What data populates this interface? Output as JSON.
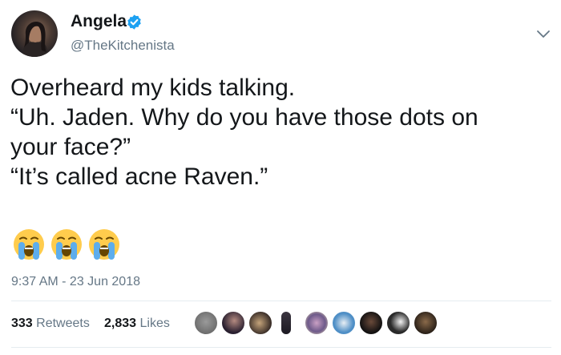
{
  "user": {
    "display_name": "Angela",
    "handle": "@TheKitchenista",
    "verified": true
  },
  "tweet": {
    "lines": [
      "Overheard my kids talking.",
      "“Uh. Jaden. Why do you have those dots on",
      "your face?”",
      "“It’s called acne Raven.”"
    ],
    "emojis": [
      "crying-face",
      "crying-face",
      "crying-face"
    ],
    "timestamp": "9:37 AM - 23 Jun 2018"
  },
  "stats": {
    "retweets_count": "333",
    "retweets_label": "Retweets",
    "likes_count": "2,833",
    "likes_label": "Likes"
  },
  "likers_count": 9,
  "colors": {
    "text": "#14171a",
    "secondary": "#657786",
    "verified": "#1da1f2",
    "divider": "#e6ecf0"
  }
}
